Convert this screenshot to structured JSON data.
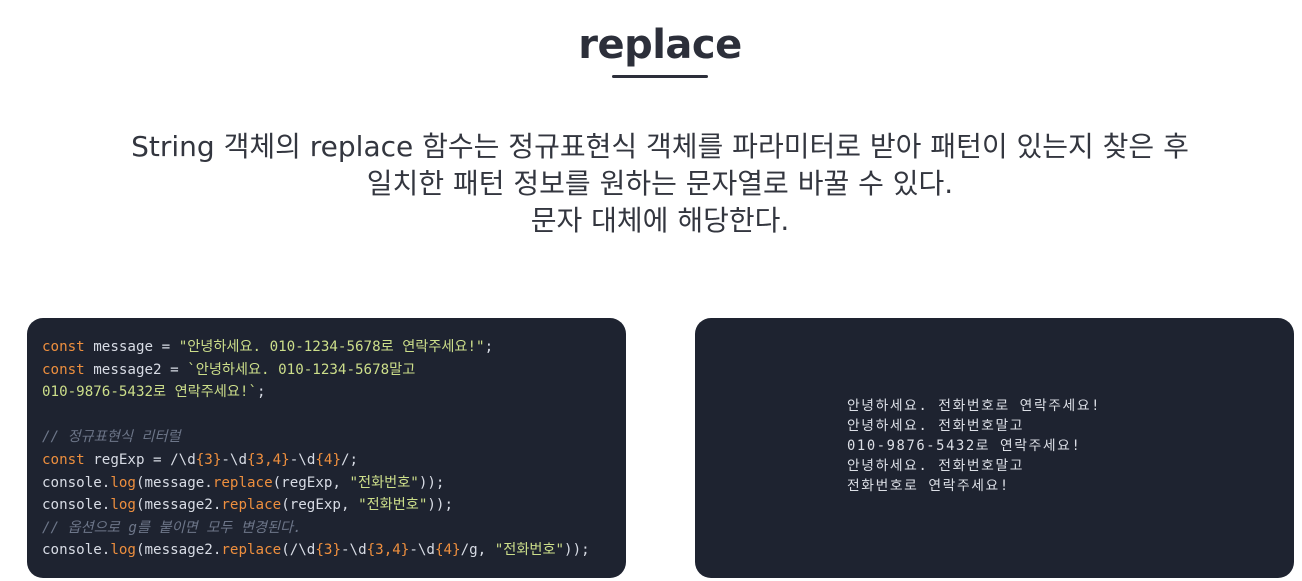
{
  "title": "replace",
  "description": [
    "String 객체의 replace 함수는 정규표현식 객체를 파라미터로 받아 패턴이 있는지 찾은 후",
    "일치한 패턴 정보를 원하는 문자열로 바꿀 수 있다.",
    "문자 대체에 해당한다."
  ],
  "code": {
    "l1": {
      "kw": "const",
      "t1": " message = ",
      "str": "\"안녕하세요. 010-1234-5678로 연락주세요!\"",
      "t2": ";"
    },
    "l2": {
      "kw": "const",
      "t1": " message2 = ",
      "str": "`안녕하세요. 010-1234-5678말고"
    },
    "l3": {
      "str": "010-9876-5432로 연락주세요!`",
      "t2": ";"
    },
    "l4": {
      "cm": "// 정규표현식 리터럴"
    },
    "l5": {
      "kw": "const",
      "t1": " regExp = /\\d",
      "n1": "{3}",
      "t2": "-\\d",
      "n2": "{3,4}",
      "t3": "-\\d",
      "n3": "{4}",
      "t4": "/;"
    },
    "l6": {
      "t1": "console.",
      "fn1": "log",
      "t2": "(message.",
      "fn2": "replace",
      "t3": "(regExp, ",
      "str": "\"전화번호\"",
      "t4": "));"
    },
    "l7": {
      "t1": "console.",
      "fn1": "log",
      "t2": "(message2.",
      "fn2": "replace",
      "t3": "(regExp, ",
      "str": "\"전화번호\"",
      "t4": "));"
    },
    "l8": {
      "cm": "// 옵션으로 g를 붙이면 모두 변경된다."
    },
    "l9": {
      "t1": "console.",
      "fn1": "log",
      "t2": "(message2.",
      "fn2": "replace",
      "t3": "(/\\d",
      "n1": "{3}",
      "t4": "-\\d",
      "n2": "{3,4}",
      "t5": "-\\d",
      "n3": "{4}",
      "t6": "/g, ",
      "str": "\"전화번호\"",
      "t7": "));"
    }
  },
  "output": [
    "안녕하세요. 전화번호로 연락주세요!",
    "안녕하세요. 전화번호말고",
    "010-9876-5432로 연락주세요!",
    "안녕하세요. 전화번호말고",
    "전화번호로 연락주세요!"
  ],
  "colors": {
    "panel_bg": "#1e2330",
    "keyword": "#ee8f3e",
    "string": "#ccde8a",
    "comment": "#6d7689",
    "text": "#d8dce5"
  }
}
